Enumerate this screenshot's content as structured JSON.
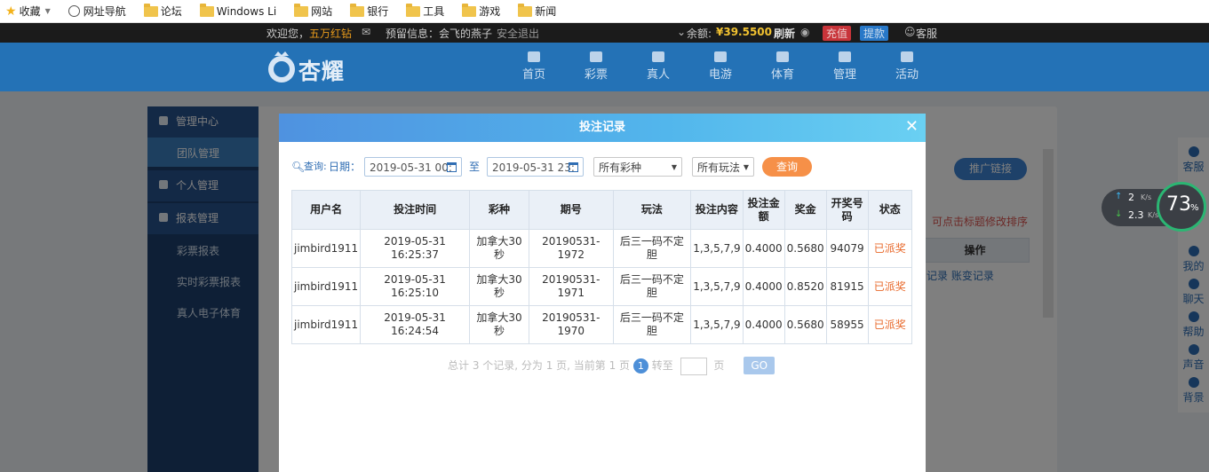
{
  "bookmarks": {
    "favorites": "收藏",
    "items": [
      "网址导航",
      "论坛",
      "Windows Li",
      "网站",
      "银行",
      "工具",
      "游戏",
      "新闻"
    ]
  },
  "topbar": {
    "welcome": "欢迎您，",
    "level": "五万红钻",
    "reserve_info": "预留信息：会飞的燕子",
    "logout": "安全退出",
    "balance_label": "余额:",
    "balance_value": "¥39.5500",
    "refresh": "刷新",
    "recharge": "充值",
    "withdraw": "提款",
    "service": "客服"
  },
  "header": {
    "logo_text": "杏耀",
    "nav": [
      "首页",
      "彩票",
      "真人",
      "电游",
      "体育",
      "管理",
      "活动"
    ]
  },
  "sidebar": {
    "sections": [
      {
        "title": "管理中心",
        "items": [
          "团队管理"
        ]
      },
      {
        "title": "个人管理",
        "items": []
      },
      {
        "title": "报表管理",
        "items": [
          "彩票报表",
          "实时彩票报表",
          "真人电子体育"
        ]
      }
    ]
  },
  "background": {
    "promo_link": "推广链接",
    "sort_hint": "可点击标题修改排序",
    "operation_header": "操作",
    "op_links": "记录 账变记录"
  },
  "right_toolbar": [
    "客服",
    "我的",
    "聊天",
    "帮助",
    "声音",
    "背景"
  ],
  "speed_widget": {
    "up": "2",
    "up_unit": "K/s",
    "down": "2.3",
    "down_unit": "K/s",
    "cpu": "73",
    "cpu_unit": "%"
  },
  "modal": {
    "title": "投注记录",
    "query_label": "查询:",
    "date_label": "日期：",
    "date_from": "2019-05-31 00:",
    "to_label": "至",
    "date_to": "2019-05-31 23:",
    "lottery_select": "所有彩种",
    "play_select": "所有玩法",
    "query_button": "查询",
    "columns": [
      "用户名",
      "投注时间",
      "彩种",
      "期号",
      "玩法",
      "投注内容",
      "投注金额",
      "奖金",
      "开奖号码",
      "状态"
    ],
    "rows": [
      [
        "jimbird1911",
        "2019-05-31 16:25:37",
        "加拿大30秒",
        "20190531-1972",
        "后三一码不定胆",
        "1,3,5,7,9",
        "0.4000",
        "0.5680",
        "94079",
        "已派奖"
      ],
      [
        "jimbird1911",
        "2019-05-31 16:25:10",
        "加拿大30秒",
        "20190531-1971",
        "后三一码不定胆",
        "1,3,5,7,9",
        "0.4000",
        "0.8520",
        "81915",
        "已派奖"
      ],
      [
        "jimbird1911",
        "2019-05-31 16:24:54",
        "加拿大30秒",
        "20190531-1970",
        "后三一码不定胆",
        "1,3,5,7,9",
        "0.4000",
        "0.5680",
        "58955",
        "已派奖"
      ]
    ],
    "pagination": {
      "summary": "总计 3 个记录, 分为 1 页, 当前第 1 页",
      "current": "1",
      "goto": "转至",
      "page_unit": "页",
      "go": "GO"
    }
  },
  "colors": {
    "header": "#2472b6",
    "accent_orange": "#f69048",
    "paid_status": "#e8682a",
    "sidebar": "#1d3f6c"
  }
}
